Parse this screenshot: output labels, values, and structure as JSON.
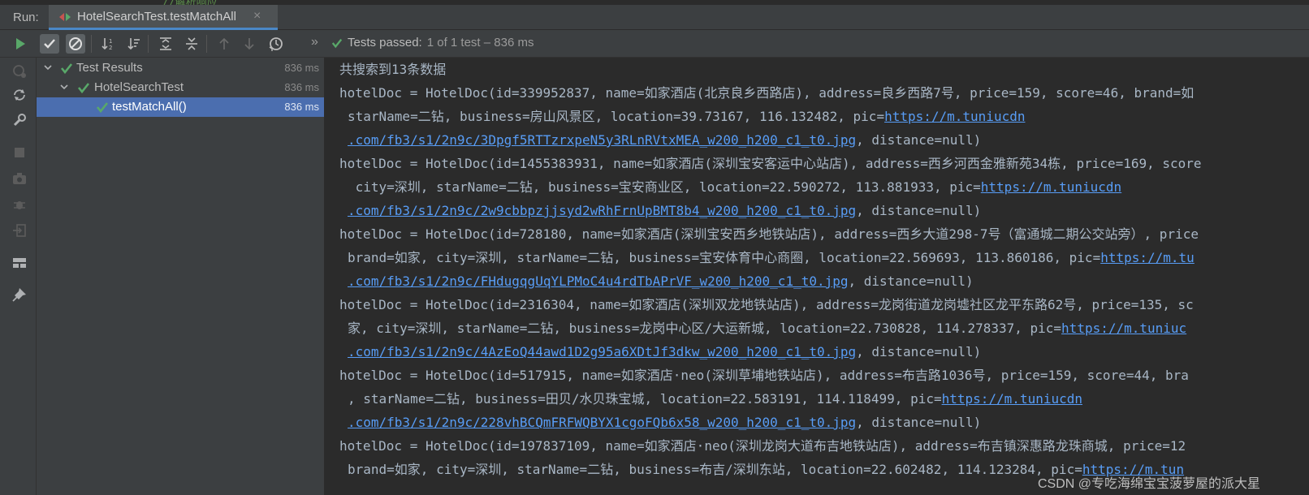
{
  "run_panel": {
    "label": "Run:",
    "tab_title": "HotelSearchTest.testMatchAll",
    "tab_close": "×",
    "code_fragment": "//解析响应"
  },
  "toolbar": {
    "expand_glyph": "»",
    "status_text": "Tests passed:",
    "status_detail": "1 of 1 test – 836 ms"
  },
  "tree": [
    {
      "label": "Test Results",
      "time": "836 ms"
    },
    {
      "label": "HotelSearchTest",
      "time": "836 ms"
    },
    {
      "label": "testMatchAll()",
      "time": "836 ms"
    }
  ],
  "console": {
    "summary": "共搜索到13条数据",
    "entries": [
      {
        "l1": "hotelDoc = HotelDoc(id=339952837, name=如家酒店(北京良乡西路店), address=良乡西路7号, price=159, score=46, brand=如",
        "l2_text": "starName=二钻, business=房山风景区, location=39.73167, 116.132482, pic=",
        "l2_link": "https://m.tuniucdn",
        "l3_link": ".com/fb3/s1/2n9c/3Dpgf5RTTzrxpeN5y3RLnRVtxMEA_w200_h200_c1_t0.jpg",
        "l3_tail": ", distance=null)"
      },
      {
        "l1": "hotelDoc = HotelDoc(id=1455383931, name=如家酒店(深圳宝安客运中心站店), address=西乡河西金雅新苑34栋, price=169, score",
        "l2_text": " city=深圳, starName=二钻, business=宝安商业区, location=22.590272, 113.881933, pic=",
        "l2_link": "https://m.tuniucdn",
        "l3_link": ".com/fb3/s1/2n9c/2w9cbbpzjjsyd2wRhFrnUpBMT8b4_w200_h200_c1_t0.jpg",
        "l3_tail": ", distance=null)"
      },
      {
        "l1": "hotelDoc = HotelDoc(id=728180, name=如家酒店(深圳宝安西乡地铁站店), address=西乡大道298-7号（富通城二期公交站旁）, price",
        "l2_text": "brand=如家, city=深圳, starName=二钻, business=宝安体育中心商圈, location=22.569693, 113.860186, pic=",
        "l2_link": "https://m.tu",
        "l3_link": ".com/fb3/s1/2n9c/FHdugqgUqYLPMoC4u4rdTbAPrVF_w200_h200_c1_t0.jpg",
        "l3_tail": ", distance=null)"
      },
      {
        "l1": "hotelDoc = HotelDoc(id=2316304, name=如家酒店(深圳双龙地铁站店), address=龙岗街道龙岗墟社区龙平东路62号, price=135, sc",
        "l2_text": "家, city=深圳, starName=二钻, business=龙岗中心区/大运新城, location=22.730828, 114.278337, pic=",
        "l2_link": "https://m.tuniuc",
        "l3_link": ".com/fb3/s1/2n9c/4AzEoQ44awd1D2g95a6XDtJf3dkw_w200_h200_c1_t0.jpg",
        "l3_tail": ", distance=null)"
      },
      {
        "l1": "hotelDoc = HotelDoc(id=517915, name=如家酒店·neo(深圳草埔地铁站店), address=布吉路1036号, price=159, score=44, bra",
        "l2_text": ", starName=二钻, business=田贝/水贝珠宝城, location=22.583191, 114.118499, pic=",
        "l2_link": "https://m.tuniucdn",
        "l3_link": ".com/fb3/s1/2n9c/228vhBCQmFRFWQBYX1cgoFQb6x58_w200_h200_c1_t0.jpg",
        "l3_tail": ", distance=null)"
      },
      {
        "l1": "hotelDoc = HotelDoc(id=197837109, name=如家酒店·neo(深圳龙岗大道布吉地铁站店), address=布吉镇深惠路龙珠商城, price=12",
        "l2_text": "brand=如家, city=深圳, starName=二钻, business=布吉/深圳东站, location=22.602482, 114.123284, pic=",
        "l2_link": "https://m.tun",
        "l3_link": "",
        "l3_tail": ""
      }
    ]
  },
  "watermark": "CSDN @专吃海绵宝宝菠萝屋的派大星",
  "colors": {
    "pass_green": "#59a869",
    "link_blue": "#589df6",
    "selection": "#4b6eaf",
    "console_bg": "#2b2b2b",
    "panel_bg": "#3c3f41"
  }
}
